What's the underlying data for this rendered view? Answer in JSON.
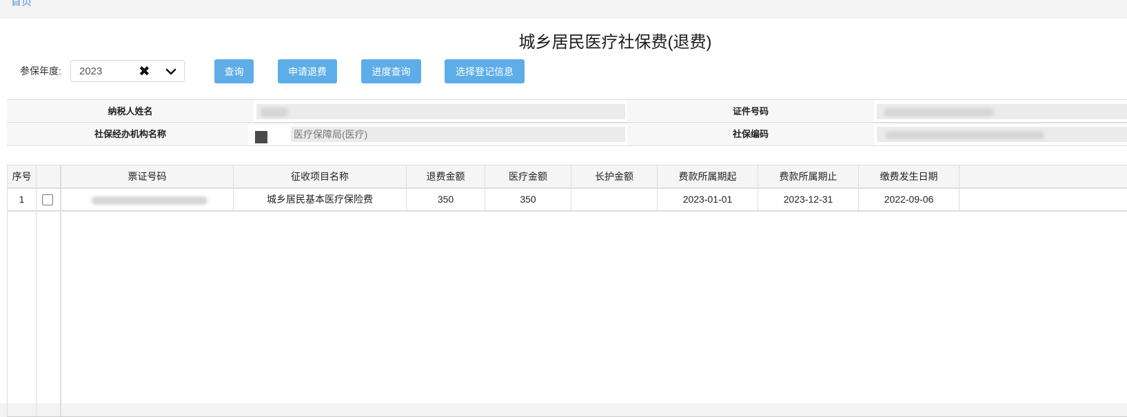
{
  "nav": {
    "back_label": "首页"
  },
  "page": {
    "title": "城乡居民医疗社保费(退费)"
  },
  "filter": {
    "year_label": "参保年度:",
    "year_value": "2023",
    "clear_icon": "clear-icon",
    "dropdown_icon": "chevron-down-icon"
  },
  "buttons": {
    "query": "查询",
    "apply_refund": "申请退费",
    "progress_query": "进度查询",
    "select_registration": "选择登记信息"
  },
  "info": {
    "taxpayer_name_label": "纳税人姓名",
    "taxpayer_name_value": "",
    "id_number_label": "证件号码",
    "id_number_value": "",
    "agency_label": "社保经办机构名称",
    "agency_value": "医疗保障局(医疗)",
    "social_code_label": "社保编码",
    "social_code_value": ""
  },
  "table": {
    "headers": [
      "序号",
      "",
      "票证号码",
      "征收项目名称",
      "退费金额",
      "医疗金额",
      "长护金额",
      "费款所属期起",
      "费款所属期止",
      "缴费发生日期"
    ],
    "rows": [
      {
        "index": "1",
        "ticket_no": "",
        "item_name": "城乡居民基本医疗保险费",
        "refund_amount": "350",
        "medical_amount": "350",
        "ltc_amount": "",
        "period_start": "2023-01-01",
        "period_end": "2023-12-31",
        "pay_date": "2022-09-06"
      }
    ]
  },
  "colors": {
    "button_bg": "#5dade8",
    "title_text": "#1a1a1a",
    "border": "#dddddd"
  }
}
